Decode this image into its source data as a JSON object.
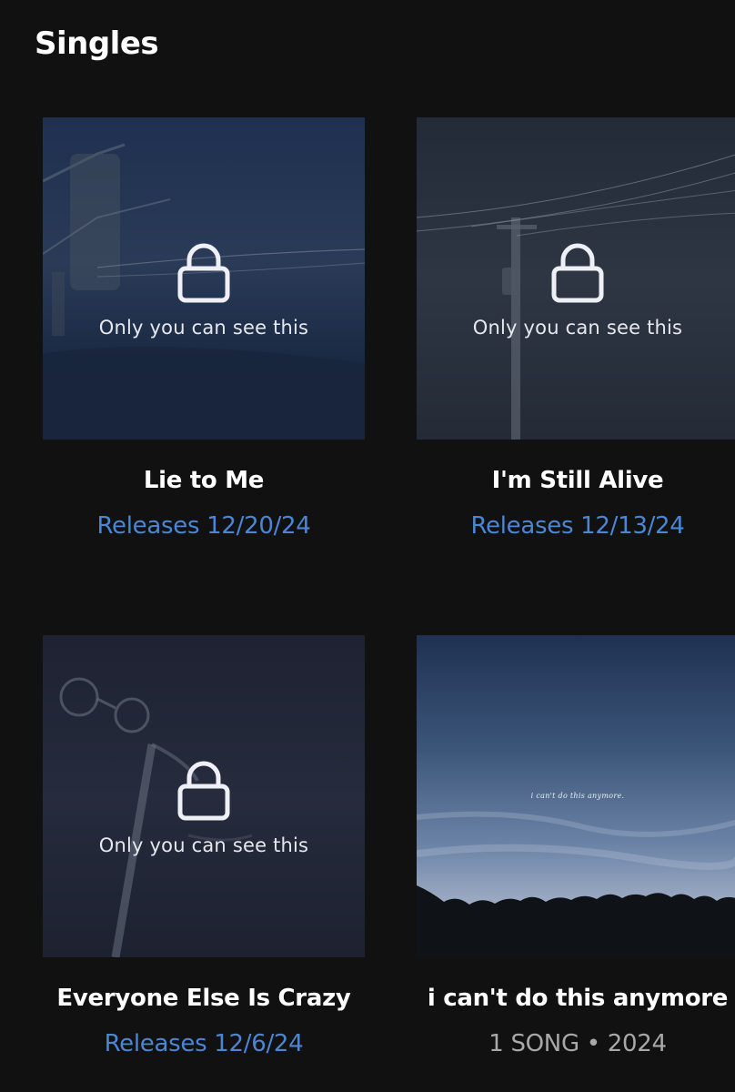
{
  "section": {
    "title": "Singles"
  },
  "private_label": "Only you can see this",
  "colors": {
    "background": "#111111",
    "release_blue": "#4a86d4",
    "meta_gray": "#a8a8a8"
  },
  "singles": [
    {
      "title": "Lie to Me",
      "subtitle": "Releases 12/20/24",
      "locked": true,
      "icon": "lock-icon"
    },
    {
      "title": "I'm Still Alive",
      "subtitle": "Releases 12/13/24",
      "locked": true,
      "icon": "lock-icon"
    },
    {
      "title": "Everyone Else Is Crazy",
      "subtitle": "Releases 12/6/24",
      "locked": true,
      "icon": "lock-icon"
    },
    {
      "title": "i can't do this anymore",
      "subtitle": "1 SONG • 2024",
      "cover_text": "i can't do this anymore.",
      "locked": false
    }
  ]
}
